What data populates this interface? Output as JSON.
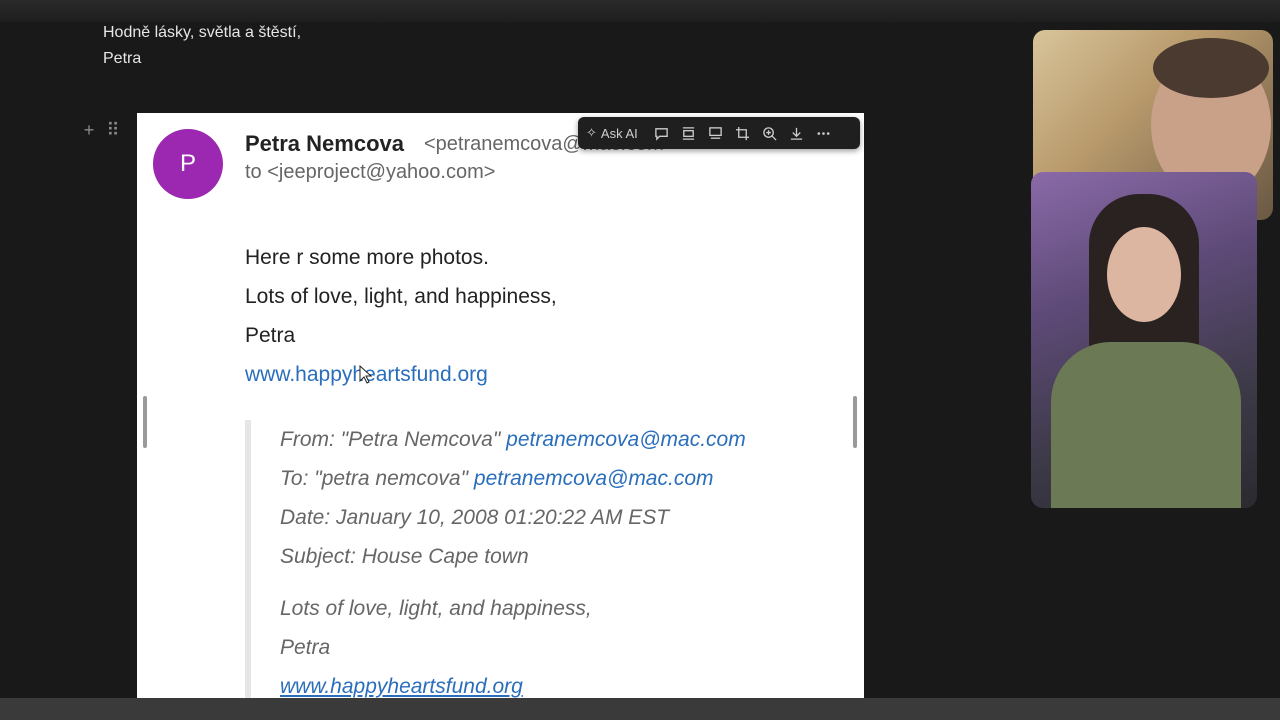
{
  "note": {
    "line1": "Hodně lásky, světla a štěstí,",
    "line2": "Petra"
  },
  "email": {
    "avatar_letter": "P",
    "avatar_color": "#9c27b0",
    "sender_name": "Petra Nemcova",
    "sender_address": "<petranemcova@mac.com>",
    "to_line": "to <jeeproject@yahoo.com>",
    "body": [
      "Here r some more photos.",
      "Lots of love, light, and happiness,",
      "Petra"
    ],
    "link": "www.happyheartsfund.org",
    "quoted": {
      "from_label": "From: \"Petra Nemcova\"",
      "from_email": "petranemcova@mac.com",
      "to_label": "To: \"petra nemcova\"",
      "to_email": "petranemcova@mac.com",
      "date": "Date: January 10, 2008 01:20:22 AM EST",
      "subject": "Subject: House Cape town",
      "body1": "Lots of love, light, and happiness,",
      "body2": "Petra",
      "link": "www.happyheartsfund.org"
    }
  },
  "toolbar": {
    "ask_ai_label": "Ask AI",
    "icons": [
      "comment-icon",
      "align-center-icon",
      "caption-icon",
      "crop-icon",
      "zoom-icon",
      "download-icon",
      "more-icon"
    ]
  },
  "colors": {
    "link": "#2a6ebb",
    "page_bg": "#191919"
  }
}
